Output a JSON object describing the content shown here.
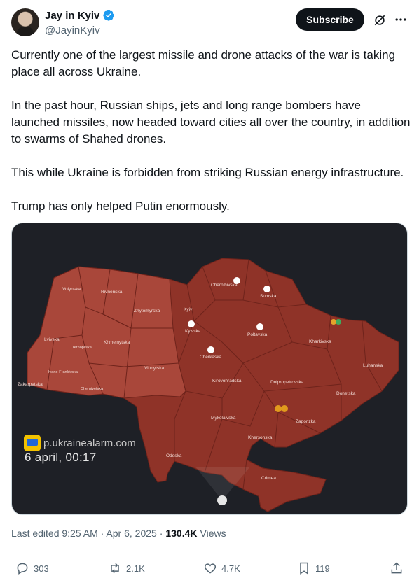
{
  "author": {
    "display_name": "Jay in Kyiv",
    "handle": "@JayinKyiv",
    "verified": true
  },
  "header": {
    "subscribe_label": "Subscribe",
    "icons": [
      "grok-icon",
      "more-icon"
    ]
  },
  "post": {
    "paragraphs": [
      "Currently one of the largest missile and drone attacks of the war is taking place all across Ukraine.",
      "In the past hour, Russian ships, jets and long range bombers have launched missiles, now headed toward cities all over the country, in addition to swarms of Shahed drones.",
      "This while Ukraine is forbidden from striking Russian energy infrastructure.",
      "Trump has only helped Putin enormously."
    ]
  },
  "media": {
    "site": "p.ukrainealarm.com",
    "date_time": "6 april, 00:17",
    "regions": {
      "volynska": "Volynska",
      "rivnenska": "Rivnenska",
      "zhytomyrska": "Zhytomyrska",
      "kyiv": "Kyiv",
      "kyivska": "Kyivska",
      "chernihivska": "Chernihivska",
      "sumska": "Sumska",
      "poltavska": "Poltavska",
      "kharkivska": "Kharkivska",
      "lvivska": "Lvivska",
      "ternopilska": "Ternopilska",
      "khmelnytska": "Khmelnytska",
      "vinnytska": "Vinnytska",
      "cherkaska": "Cherkaska",
      "ivano_frankivska": "Ivano-Frankivska",
      "zakarpatska": "Zakarpatska",
      "chernivetska": "Chernivetska",
      "kirovohradska": "Kirovohradska",
      "dnipropetrovska": "Dnipropetrovska",
      "luhanska": "Luhanska",
      "donetska": "Donetska",
      "zaporizka": "Zaporizka",
      "mykolaivska": "Mykolaivska",
      "khersonska": "Khersonska",
      "odeska": "Odeska",
      "crimea": "Crimea"
    },
    "colors": {
      "background": "#1e2026",
      "alert_region": "#8f3328",
      "west_region": "#a9473a",
      "border": "#6e231b"
    }
  },
  "meta": {
    "edited": "Last edited 9:25 AM · Apr 6, 2025 ·",
    "views_count": "130.4K",
    "views_label": "Views"
  },
  "actions": {
    "replies": "303",
    "reposts": "2.1K",
    "likes": "4.7K",
    "bookmarks": "119"
  }
}
